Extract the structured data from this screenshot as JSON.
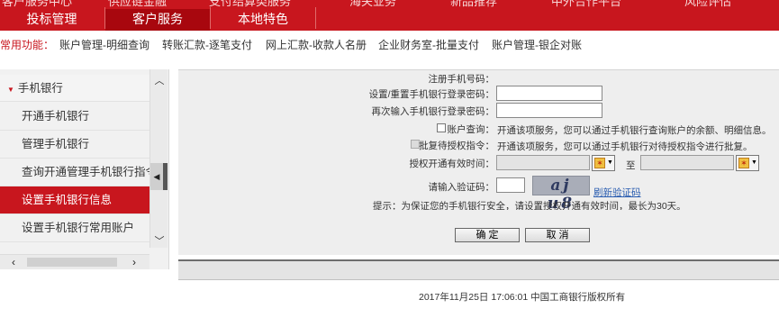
{
  "top_nav": {
    "row1": [
      "客户服务中心",
      "供应链金融",
      "支付结算类服务",
      "海关业务",
      "新品推荐",
      "中外合作平台",
      "风险评估"
    ],
    "row2": [
      "投标管理",
      "客户服务",
      "本地特色"
    ],
    "active": "客户服务"
  },
  "common_functions": {
    "label": "常用功能：",
    "links": [
      "账户管理-明细查询",
      "转账汇款-逐笔支付",
      "网上汇款-收款人名册",
      "企业财务室-批量支付",
      "账户管理-银企对账"
    ]
  },
  "sidebar": {
    "group": "手机银行",
    "items": [
      "开通手机银行",
      "管理手机银行",
      "查询开通管理手机银行指令",
      "设置手机银行信息",
      "设置手机银行常用账户"
    ],
    "active_index": 3
  },
  "form": {
    "phone_label": "注册手机号码：",
    "set_password_label": "设置/重置手机银行登录密码：",
    "reenter_password_label": "再次输入手机银行登录密码：",
    "account_query_label": "账户查询：",
    "account_query_desc": "开通该项服务，您可以通过手机银行查询账户的余额、明细信息。",
    "approve_label": "批复待授权指令：",
    "approve_desc": "开通该项服务，您可以通过手机银行对待授权指令进行批复。",
    "validity_label": "授权开通有效时间：",
    "to_label": "至",
    "captcha_label": "请输入验证码：",
    "captcha_text": "aj u8",
    "refresh_label": "刷新验证码",
    "hint": "提示：为保证您的手机银行安全，请设置授权开通有效时间，最长为30天。"
  },
  "buttons": {
    "confirm": "确 定",
    "cancel": "取 消"
  },
  "footer": "2017年11月25日  17:06:01     中国工商银行版权所有"
}
